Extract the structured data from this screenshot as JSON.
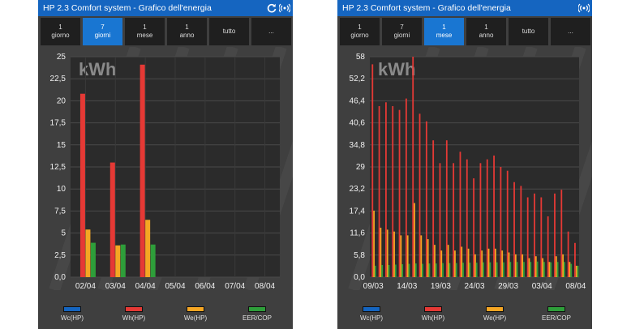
{
  "panels": [
    {
      "title": "HP 2.3 Comfort system - Grafico dell'energia",
      "tabs": [
        {
          "label": "1\ngiorno",
          "active": false
        },
        {
          "label": "7\ngiorni",
          "active": true
        },
        {
          "label": "1\nmese",
          "active": false
        },
        {
          "label": "1\nanno",
          "active": false
        },
        {
          "label": "tutto",
          "active": false
        },
        {
          "label": "...",
          "active": false
        }
      ],
      "legend": [
        {
          "label": "Wc(HP)",
          "color": "#1565c0"
        },
        {
          "label": "Wh(HP)",
          "color": "#e53935"
        },
        {
          "label": "We(HP)",
          "color": "#f5a623"
        },
        {
          "label": "EER/COP",
          "color": "#2e9e3a"
        }
      ],
      "unit_label": "kWh"
    },
    {
      "title": "HP 2.3 Comfort system - Grafico dell'energia",
      "tabs": [
        {
          "label": "1\ngiorno",
          "active": false
        },
        {
          "label": "7\ngiorni",
          "active": false
        },
        {
          "label": "1\nmese",
          "active": true
        },
        {
          "label": "1\nanno",
          "active": false
        },
        {
          "label": "tutto",
          "active": false
        },
        {
          "label": "...",
          "active": false
        }
      ],
      "legend": [
        {
          "label": "Wc(HP)",
          "color": "#1565c0"
        },
        {
          "label": "Wh(HP)",
          "color": "#e53935"
        },
        {
          "label": "We(HP)",
          "color": "#f5a623"
        },
        {
          "label": "EER/COP",
          "color": "#2e9e3a"
        }
      ],
      "unit_label": "kWh"
    }
  ],
  "chart_data": [
    {
      "type": "bar",
      "title": "kWh",
      "categories": [
        "02/04",
        "03/04",
        "04/04",
        "05/04",
        "06/04",
        "07/04",
        "08/04"
      ],
      "series": [
        {
          "name": "Wc(HP)",
          "values": [
            0,
            0,
            0,
            0,
            0,
            0,
            0
          ]
        },
        {
          "name": "Wh(HP)",
          "values": [
            20.8,
            13.0,
            24.1,
            0,
            0,
            0,
            0
          ]
        },
        {
          "name": "We(HP)",
          "values": [
            5.4,
            3.6,
            6.5,
            0,
            0,
            0,
            0
          ]
        },
        {
          "name": "EER/COP",
          "values": [
            3.9,
            3.7,
            3.7,
            0,
            0,
            0,
            0
          ]
        }
      ],
      "yticks": [
        "0,0",
        "2,5",
        "5",
        "7,5",
        "10",
        "12,5",
        "15",
        "17,5",
        "20",
        "22,5",
        "25"
      ],
      "ylim": [
        0,
        25
      ],
      "grid": true
    },
    {
      "type": "bar",
      "title": "kWh",
      "x_labels": [
        "09/03",
        "14/03",
        "19/03",
        "24/03",
        "29/03",
        "03/04",
        "08/04"
      ],
      "x_label_positions": [
        1,
        6,
        11,
        16,
        21,
        26,
        31
      ],
      "n_days": 31,
      "series": [
        {
          "name": "Wc(HP)",
          "values": [
            0,
            0,
            0,
            0,
            0,
            0,
            0,
            0,
            0,
            0,
            0,
            0,
            0,
            0,
            0,
            0,
            0,
            0,
            0,
            0,
            0,
            0,
            0,
            0,
            0,
            0,
            0,
            0,
            0,
            0,
            0
          ]
        },
        {
          "name": "Wh(HP)",
          "values": [
            56,
            45,
            46,
            45,
            44,
            47,
            58,
            43,
            41,
            36,
            30,
            36,
            30,
            33,
            31,
            26,
            30,
            31,
            32,
            29,
            28,
            25,
            24,
            21,
            22,
            21,
            16,
            22,
            23,
            12,
            9
          ]
        },
        {
          "name": "We(HP)",
          "values": [
            17.5,
            13,
            12.5,
            12,
            11,
            11,
            19.5,
            11,
            10,
            8.5,
            7,
            8.5,
            7,
            8,
            7.5,
            6,
            7,
            7.5,
            7.5,
            7,
            6.5,
            6,
            6,
            5,
            5.5,
            5,
            4,
            5.5,
            6,
            4,
            3
          ]
        },
        {
          "name": "EER/COP",
          "values": [
            3,
            3.2,
            3.2,
            3.3,
            3.4,
            3.5,
            3.6,
            3.5,
            3.6,
            3.6,
            3.7,
            3.7,
            3.7,
            3.8,
            3.8,
            3.8,
            3.9,
            3.9,
            3.9,
            3.9,
            4,
            4,
            4,
            4,
            4.1,
            4,
            3.9,
            4,
            4,
            3.5,
            3
          ]
        }
      ],
      "yticks": [
        "0,0",
        "5,8",
        "11,6",
        "17,4",
        "23,2",
        "29",
        "34,8",
        "40,6",
        "46,4",
        "52,2",
        "58"
      ],
      "ylim": [
        0,
        58
      ],
      "grid": true
    }
  ]
}
